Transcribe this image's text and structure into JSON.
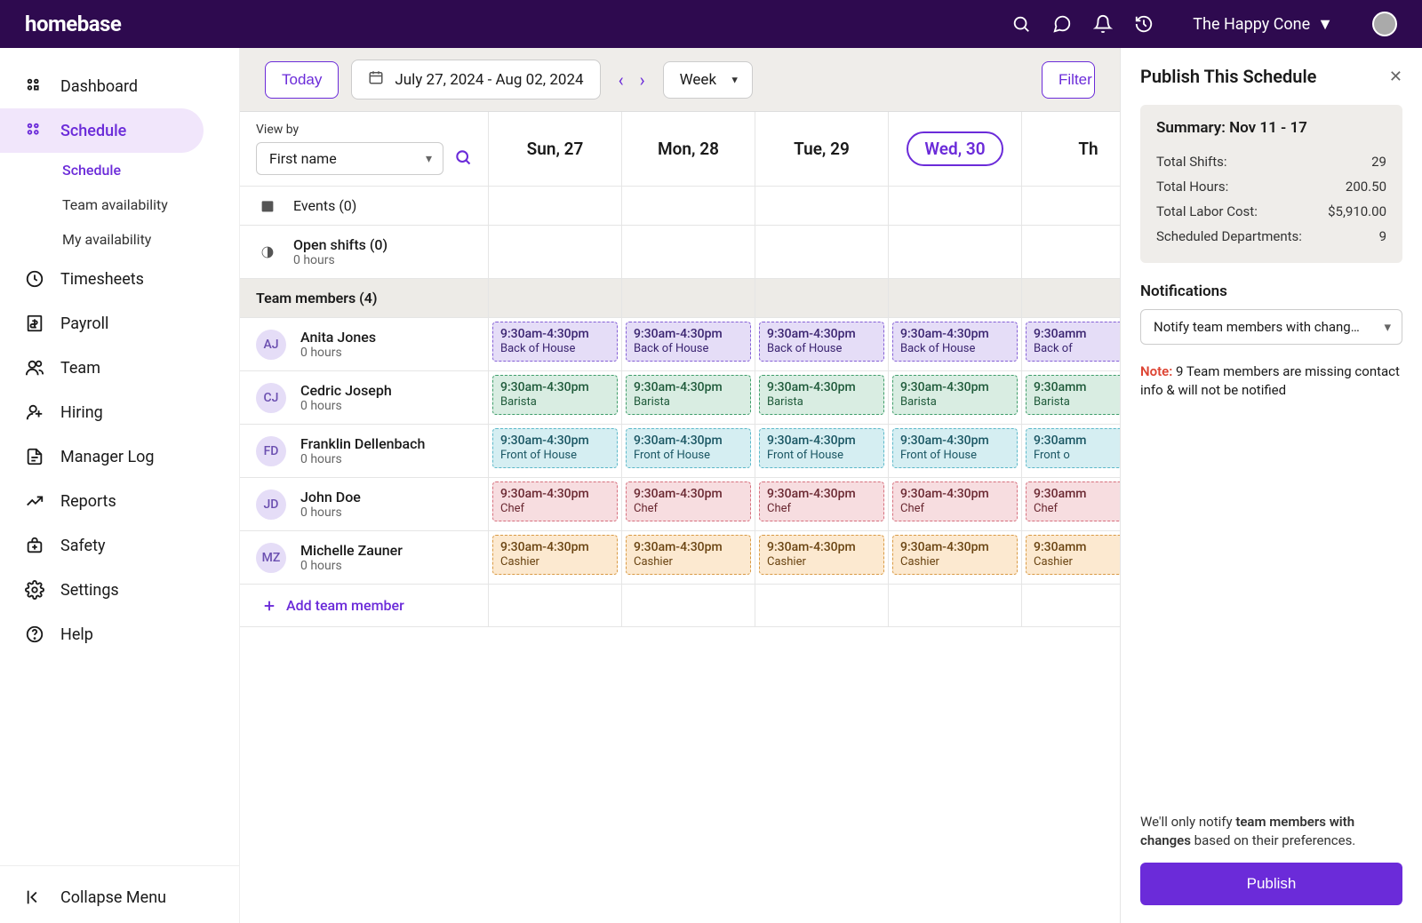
{
  "header": {
    "logo": "homebase",
    "company": "The Happy Cone"
  },
  "sidebar": {
    "items": [
      {
        "label": "Dashboard"
      },
      {
        "label": "Schedule"
      },
      {
        "label": "Timesheets"
      },
      {
        "label": "Payroll"
      },
      {
        "label": "Team"
      },
      {
        "label": "Hiring"
      },
      {
        "label": "Manager Log"
      },
      {
        "label": "Reports"
      },
      {
        "label": "Safety"
      },
      {
        "label": "Settings"
      },
      {
        "label": "Help"
      }
    ],
    "sub_items": [
      {
        "label": "Schedule"
      },
      {
        "label": "Team availability"
      },
      {
        "label": "My availability"
      }
    ],
    "collapse": "Collapse Menu"
  },
  "toolbar": {
    "today": "Today",
    "date_range": "July 27, 2024 - Aug 02, 2024",
    "period": "Week",
    "filter": "Filter"
  },
  "grid": {
    "view_by_label": "View by",
    "view_by_value": "First name",
    "days": [
      "Sun, 27",
      "Mon, 28",
      "Tue, 29",
      "Wed, 30",
      "Th"
    ],
    "today_index": 3,
    "events_label": "Events (0)",
    "open_shifts_label": "Open shifts (0)",
    "open_shifts_hours": "0 hours",
    "team_members_label": "Team members (4)",
    "add_member": "Add team member",
    "members": [
      {
        "initials": "AJ",
        "name": "Anita Jones",
        "hours": "0 hours",
        "avatar_bg": "#e5ddf7",
        "avatar_fg": "#6b4fb0",
        "role": "Back of House",
        "color": "purple",
        "time": "9:30am-4:30pm"
      },
      {
        "initials": "CJ",
        "name": "Cedric Joseph",
        "hours": "0 hours",
        "avatar_bg": "#e5ddf7",
        "avatar_fg": "#6b4fb0",
        "role": "Barista",
        "color": "green",
        "time": "9:30am-4:30pm"
      },
      {
        "initials": "FD",
        "name": "Franklin Dellenbach",
        "hours": "0 hours",
        "avatar_bg": "#e5ddf7",
        "avatar_fg": "#6b4fb0",
        "role": "Front of House",
        "color": "blue",
        "time": "9:30am-4:30pm"
      },
      {
        "initials": "JD",
        "name": "John Doe",
        "hours": "0 hours",
        "avatar_bg": "#e5ddf7",
        "avatar_fg": "#6b4fb0",
        "role": "Chef",
        "color": "pink",
        "time": "9:30am-4:30pm"
      },
      {
        "initials": "MZ",
        "name": "Michelle Zauner",
        "hours": "0 hours",
        "avatar_bg": "#e5ddf7",
        "avatar_fg": "#6b4fb0",
        "role": "Cashier",
        "color": "orange",
        "time": "9:30am-4:30pm"
      }
    ]
  },
  "panel": {
    "title": "Publish This Schedule",
    "summary_title": "Summary: Nov 11 - 17",
    "rows": [
      {
        "label": "Total Shifts:",
        "value": "29"
      },
      {
        "label": "Total Hours:",
        "value": "200.50"
      },
      {
        "label": "Total Labor Cost:",
        "value": "$5,910.00"
      },
      {
        "label": "Scheduled Departments:",
        "value": "9"
      }
    ],
    "notifications_title": "Notifications",
    "notify_value": "Notify team members with chang…",
    "note_label": "Note:",
    "note_text": " 9 Team members are missing contact info & will not be notified",
    "footer_prefix": "We'll only notify ",
    "footer_bold": "team members with changes",
    "footer_suffix": " based on their preferences.",
    "publish": "Publish"
  }
}
